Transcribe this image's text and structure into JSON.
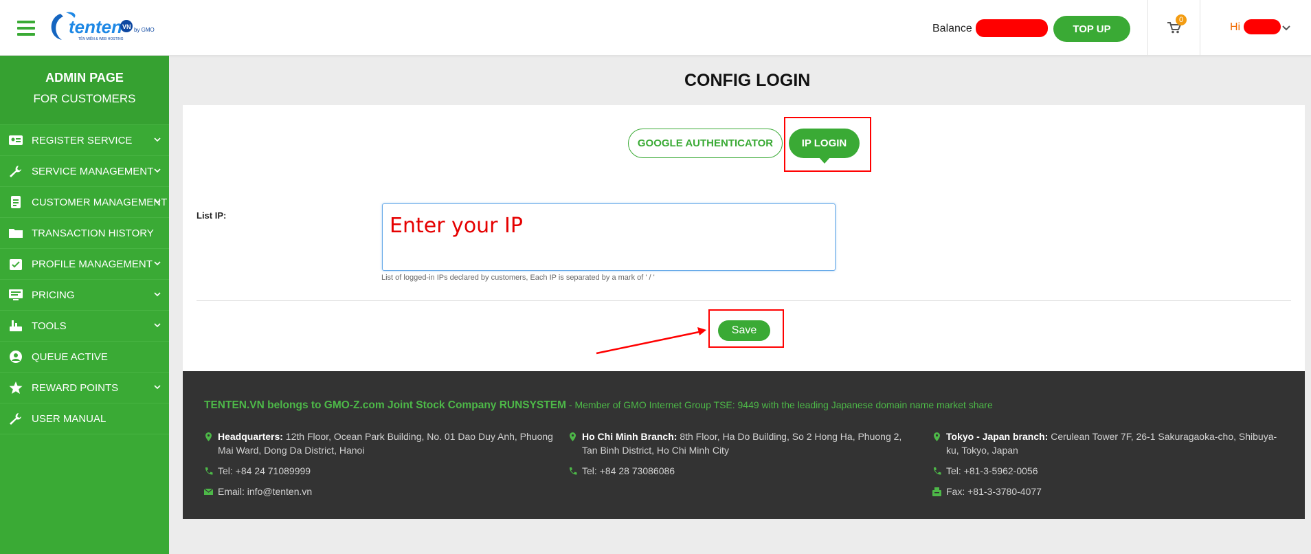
{
  "header": {
    "logo_alt": "tenten.vn by GMO",
    "balance_label": "Balance :",
    "topup_label": "TOP UP",
    "cart_count": "0",
    "greeting": "Hi"
  },
  "sidebar": {
    "title": "ADMIN PAGE",
    "subtitle": "FOR CUSTOMERS",
    "items": [
      {
        "label": "REGISTER SERVICE",
        "icon": "id-card-icon",
        "has_submenu": true
      },
      {
        "label": "SERVICE MANAGEMENT",
        "icon": "wrench-icon",
        "has_submenu": true
      },
      {
        "label": "CUSTOMER MANAGEMENT",
        "icon": "document-icon",
        "has_submenu": true
      },
      {
        "label": "TRANSACTION HISTORY",
        "icon": "folder-icon",
        "has_submenu": false
      },
      {
        "label": "PROFILE MANAGEMENT",
        "icon": "calendar-check-icon",
        "has_submenu": true
      },
      {
        "label": "PRICING",
        "icon": "monitor-icon",
        "has_submenu": true
      },
      {
        "label": "TOOLS",
        "icon": "tools-icon",
        "has_submenu": true
      },
      {
        "label": "QUEUE ACTIVE",
        "icon": "user-circle-icon",
        "has_submenu": false
      },
      {
        "label": "REWARD POINTS",
        "icon": "star-icon",
        "has_submenu": true
      },
      {
        "label": "USER MANUAL",
        "icon": "wrench-icon",
        "has_submenu": false
      }
    ]
  },
  "main": {
    "title": "CONFIG LOGIN",
    "tabs": [
      {
        "label": "GOOGLE AUTHENTICATOR",
        "active": false
      },
      {
        "label": "IP LOGIN",
        "active": true
      }
    ],
    "list_ip_label": "List IP:",
    "list_ip_value": "Enter your IP",
    "help_text": "List of logged-in IPs declared by customers, Each IP is separated by a mark of ' / '",
    "save_label": "Save"
  },
  "footer": {
    "company_bold": "TENTEN.VN belongs to GMO-Z.com Joint Stock Company RUNSYSTEM",
    "company_rest": " - Member of GMO Internet Group TSE: 9449 with the leading Japanese domain name market share",
    "columns": [
      {
        "title": "Headquarters:",
        "address": " 12th Floor, Ocean Park Building, No. 01 Dao Duy Anh, Phuong Mai Ward, Dong Da District, Hanoi",
        "contact1": "Tel: +84 24 71089999",
        "contact2": "Email: info@tenten.vn"
      },
      {
        "title": "Ho Chi Minh Branch:",
        "address": " 8th Floor, Ha Do Building, So 2 Hong Ha, Phuong 2, Tan Binh District, Ho Chi Minh City",
        "contact1": "Tel: +84 28 73086086"
      },
      {
        "title": "Tokyo - Japan branch:",
        "address": " Cerulean Tower 7F, 26-1 Sakuragaoka-cho, Shibuya-ku, Tokyo, Japan",
        "contact1": "Tel: +81-3-5962-0056",
        "contact2": "Fax: +81-3-3780-4077"
      }
    ]
  },
  "colors": {
    "brand_green": "#3aaa35",
    "annotation_red": "#ff0000",
    "footer_bg": "#333333",
    "accent_orange": "#f06a00"
  }
}
